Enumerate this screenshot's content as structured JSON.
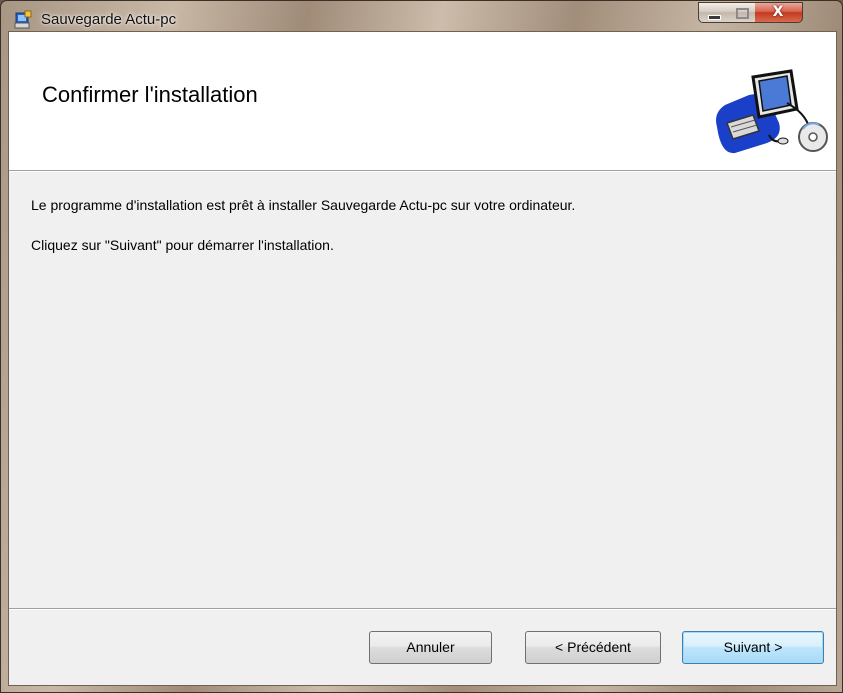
{
  "window": {
    "title": "Sauvegarde Actu-pc",
    "app_icon": "installer-icon",
    "controls": {
      "minimize": "minimize-icon",
      "maximize": "maximize-icon",
      "close_glyph": "X"
    }
  },
  "header": {
    "title": "Confirmer l'installation",
    "graphic": "computer-cd-icon"
  },
  "body": {
    "line1": "Le programme d'installation est prêt à installer Sauvegarde Actu-pc sur votre ordinateur.",
    "line2": "Cliquez sur \"Suivant\" pour démarrer l'installation."
  },
  "buttons": {
    "cancel": "Annuler",
    "previous": "< Précédent",
    "next": "Suivant >"
  },
  "colors": {
    "close_button": "#c23a20",
    "default_button_border": "#3c7fb1",
    "client_bg": "#f0f0f0"
  }
}
